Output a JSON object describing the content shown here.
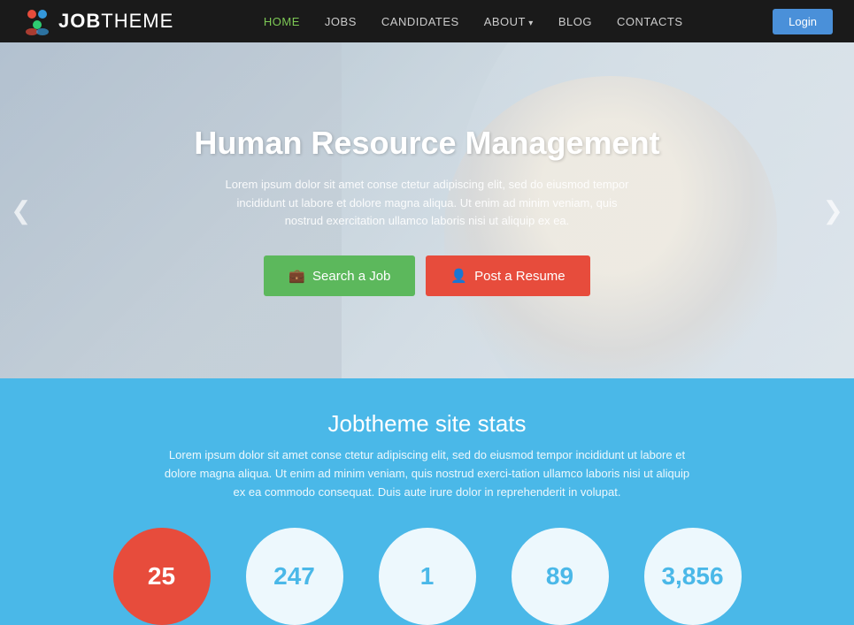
{
  "header": {
    "logo_job": "JOB",
    "logo_theme": "THEME",
    "nav": {
      "home": "HOME",
      "jobs": "JOBS",
      "candidates": "CANDIDATES",
      "about": "ABOUT",
      "blog": "BLOG",
      "contacts": "CONTACTS"
    },
    "login_label": "Login"
  },
  "hero": {
    "title": "Human Resource Management",
    "subtitle": "Lorem ipsum dolor sit amet conse ctetur adipiscing elit, sed do eiusmod tempor incididunt ut labore et dolore magna aliqua. Ut enim ad minim veniam, quis nostrud exercitation ullamco laboris nisi ut aliquip ex ea.",
    "search_btn": "Search a Job",
    "resume_btn": "Post a Resume",
    "arrow_left": "❮",
    "arrow_right": "❯"
  },
  "stats": {
    "title": "Jobtheme site stats",
    "description": "Lorem ipsum dolor sit amet conse ctetur adipiscing elit, sed do eiusmod tempor incididunt ut labore et dolore magna aliqua. Ut enim ad minim veniam, quis nostrud exerci-tation ullamco laboris nisi ut aliquip ex ea commodo consequat. Duis aute irure dolor in reprehenderit in volupat.",
    "circles": [
      {
        "value": "25",
        "color": "red"
      },
      {
        "value": "247",
        "color": "white"
      },
      {
        "value": "1",
        "color": "white"
      },
      {
        "value": "89",
        "color": "white"
      },
      {
        "value": "3,856",
        "color": "white"
      }
    ]
  },
  "icons": {
    "briefcase": "💼",
    "user": "👤",
    "logo_people": "👥"
  }
}
